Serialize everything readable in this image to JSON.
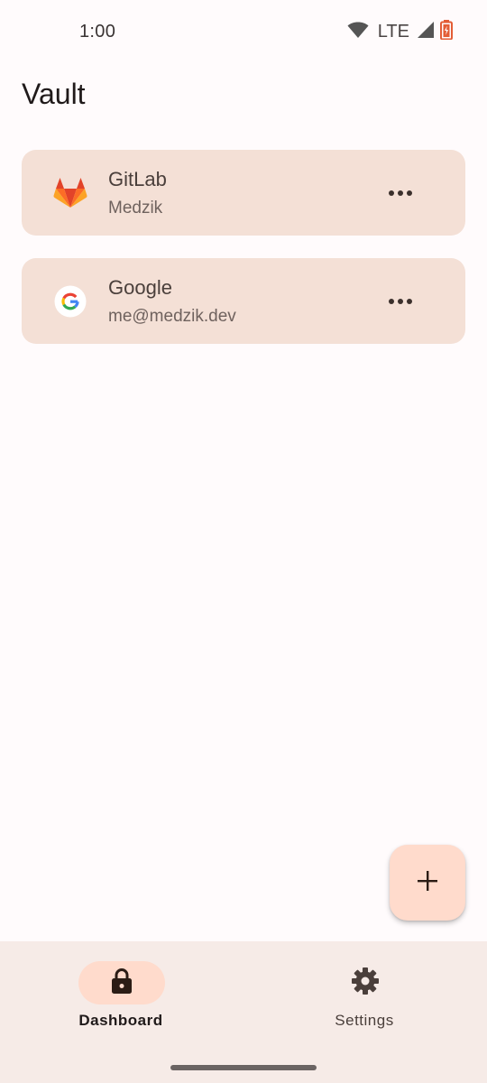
{
  "status_bar": {
    "time": "1:00",
    "network": "LTE",
    "icons": [
      "wifi-icon",
      "cell-signal-icon",
      "battery-icon"
    ]
  },
  "app": {
    "title": "Vault"
  },
  "vault": {
    "items": [
      {
        "name": "GitLab",
        "username": "Medzik",
        "icon": "gitlab-icon",
        "menu_icon": "more-horiz-icon"
      },
      {
        "name": "Google",
        "username": "me@medzik.dev",
        "icon": "google-icon",
        "menu_icon": "more-horiz-icon"
      }
    ]
  },
  "fab": {
    "icon": "add-icon"
  },
  "bottom_nav": {
    "items": [
      {
        "label": "Dashboard",
        "icon": "lock-icon",
        "selected": true
      },
      {
        "label": "Settings",
        "icon": "gear-icon",
        "selected": false
      }
    ]
  },
  "colors": {
    "background": "#fffbfc",
    "card": "#f4e0d6",
    "accent_container": "#ffdbcc",
    "nav_background": "#f6ebe7"
  }
}
